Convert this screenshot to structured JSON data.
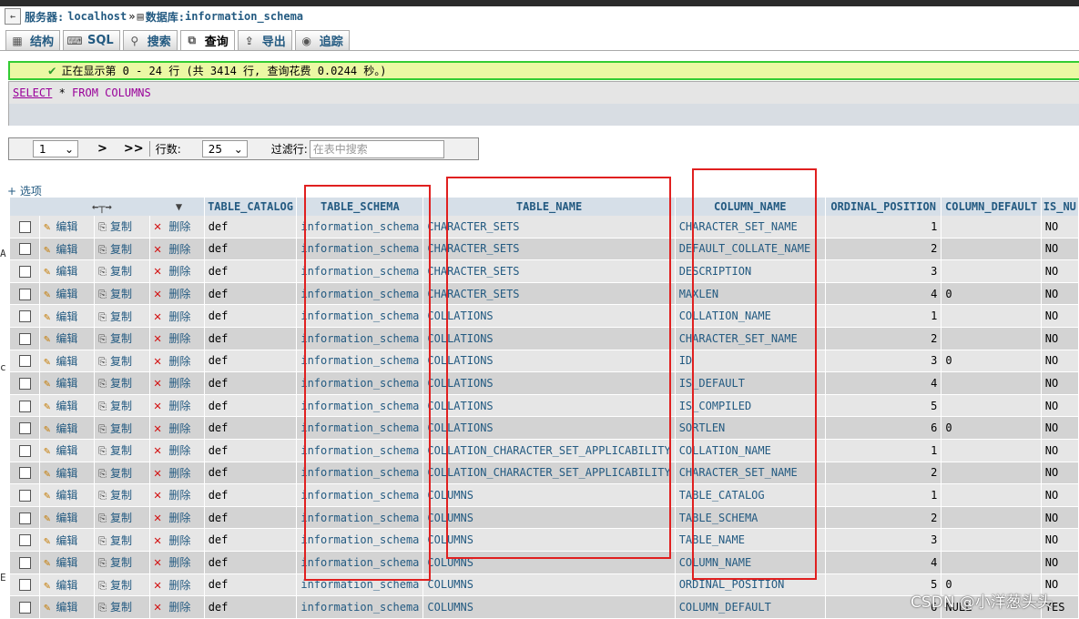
{
  "breadcrumb": {
    "server_label": "服务器:",
    "server": "localhost",
    "sep": "»",
    "db_label": "数据库:",
    "db": "information_schema"
  },
  "tabs": [
    {
      "label": "结构",
      "icon": "structure-icon"
    },
    {
      "label": "SQL",
      "icon": "sql-icon"
    },
    {
      "label": "搜索",
      "icon": "search-icon"
    },
    {
      "label": "查询",
      "icon": "query-icon"
    },
    {
      "label": "导出",
      "icon": "export-icon"
    },
    {
      "label": "追踪",
      "icon": "tracking-icon"
    }
  ],
  "status": {
    "message": "正在显示第 0 - 24 行 (共 3414 行, 查询花费 0.0244 秒。)"
  },
  "sql": {
    "select": "SELECT",
    "star": " * ",
    "from": "FROM",
    "table": " COLUMNS"
  },
  "nav": {
    "page": "1",
    "next": ">",
    "last": ">>",
    "rows_label": "行数:",
    "rows": "25",
    "filter_label": "过滤行:",
    "filter_placeholder": "在表中搜索"
  },
  "options_label": "+ 选项",
  "actions": {
    "edit": "编辑",
    "copy": "复制",
    "delete": "删除"
  },
  "columns": [
    "TABLE_CATALOG",
    "TABLE_SCHEMA",
    "TABLE_NAME",
    "COLUMN_NAME",
    "ORDINAL_POSITION",
    "COLUMN_DEFAULT",
    "IS_NU"
  ],
  "rows": [
    {
      "catalog": "def",
      "schema": "information_schema",
      "table": "CHARACTER_SETS",
      "column": "CHARACTER_SET_NAME",
      "pos": "1",
      "default": "",
      "nullable": "NO"
    },
    {
      "catalog": "def",
      "schema": "information_schema",
      "table": "CHARACTER_SETS",
      "column": "DEFAULT_COLLATE_NAME",
      "pos": "2",
      "default": "",
      "nullable": "NO"
    },
    {
      "catalog": "def",
      "schema": "information_schema",
      "table": "CHARACTER_SETS",
      "column": "DESCRIPTION",
      "pos": "3",
      "default": "",
      "nullable": "NO"
    },
    {
      "catalog": "def",
      "schema": "information_schema",
      "table": "CHARACTER_SETS",
      "column": "MAXLEN",
      "pos": "4",
      "default": "0",
      "nullable": "NO"
    },
    {
      "catalog": "def",
      "schema": "information_schema",
      "table": "COLLATIONS",
      "column": "COLLATION_NAME",
      "pos": "1",
      "default": "",
      "nullable": "NO"
    },
    {
      "catalog": "def",
      "schema": "information_schema",
      "table": "COLLATIONS",
      "column": "CHARACTER_SET_NAME",
      "pos": "2",
      "default": "",
      "nullable": "NO"
    },
    {
      "catalog": "def",
      "schema": "information_schema",
      "table": "COLLATIONS",
      "column": "ID",
      "pos": "3",
      "default": "0",
      "nullable": "NO"
    },
    {
      "catalog": "def",
      "schema": "information_schema",
      "table": "COLLATIONS",
      "column": "IS_DEFAULT",
      "pos": "4",
      "default": "",
      "nullable": "NO"
    },
    {
      "catalog": "def",
      "schema": "information_schema",
      "table": "COLLATIONS",
      "column": "IS_COMPILED",
      "pos": "5",
      "default": "",
      "nullable": "NO"
    },
    {
      "catalog": "def",
      "schema": "information_schema",
      "table": "COLLATIONS",
      "column": "SORTLEN",
      "pos": "6",
      "default": "0",
      "nullable": "NO"
    },
    {
      "catalog": "def",
      "schema": "information_schema",
      "table": "COLLATION_CHARACTER_SET_APPLICABILITY",
      "column": "COLLATION_NAME",
      "pos": "1",
      "default": "",
      "nullable": "NO"
    },
    {
      "catalog": "def",
      "schema": "information_schema",
      "table": "COLLATION_CHARACTER_SET_APPLICABILITY",
      "column": "CHARACTER_SET_NAME",
      "pos": "2",
      "default": "",
      "nullable": "NO"
    },
    {
      "catalog": "def",
      "schema": "information_schema",
      "table": "COLUMNS",
      "column": "TABLE_CATALOG",
      "pos": "1",
      "default": "",
      "nullable": "NO"
    },
    {
      "catalog": "def",
      "schema": "information_schema",
      "table": "COLUMNS",
      "column": "TABLE_SCHEMA",
      "pos": "2",
      "default": "",
      "nullable": "NO"
    },
    {
      "catalog": "def",
      "schema": "information_schema",
      "table": "COLUMNS",
      "column": "TABLE_NAME",
      "pos": "3",
      "default": "",
      "nullable": "NO"
    },
    {
      "catalog": "def",
      "schema": "information_schema",
      "table": "COLUMNS",
      "column": "COLUMN_NAME",
      "pos": "4",
      "default": "",
      "nullable": "NO"
    },
    {
      "catalog": "def",
      "schema": "information_schema",
      "table": "COLUMNS",
      "column": "ORDINAL_POSITION",
      "pos": "5",
      "default": "0",
      "nullable": "NO"
    },
    {
      "catalog": "def",
      "schema": "information_schema",
      "table": "COLUMNS",
      "column": "COLUMN_DEFAULT",
      "pos": "6",
      "default": "NULL",
      "nullable": "YES"
    }
  ],
  "watermark": "CSDN @小洋葱头头",
  "colors": {
    "highlight": "#e02020",
    "header_bg": "#d6dfe8",
    "link": "#235a81",
    "success_border": "#33cc33"
  }
}
